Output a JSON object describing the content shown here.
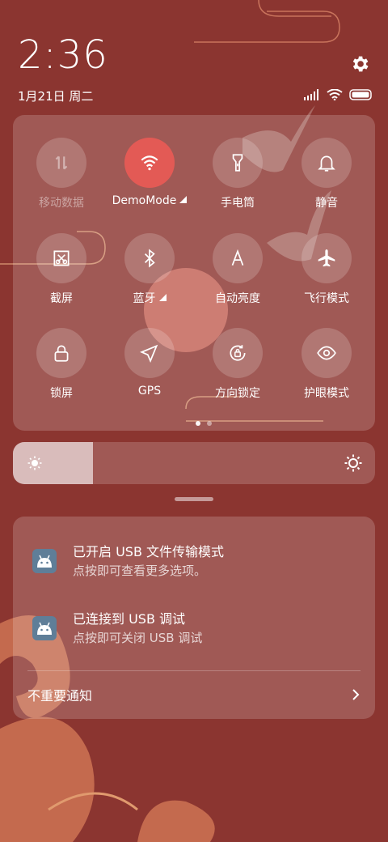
{
  "status": {
    "time": "2:36",
    "date": "1月21日 周二",
    "icons": [
      "signal-icon",
      "wifi-icon",
      "battery-icon"
    ]
  },
  "quick_settings": {
    "tiles": [
      {
        "label": "移动数据",
        "icon": "mobile-data-icon",
        "active": false,
        "disabled": true
      },
      {
        "label": "DemoMode",
        "icon": "wifi-icon",
        "active": true,
        "expand": true
      },
      {
        "label": "手电筒",
        "icon": "flashlight-icon",
        "active": false
      },
      {
        "label": "静音",
        "icon": "bell-icon",
        "active": false
      },
      {
        "label": "截屏",
        "icon": "screenshot-icon",
        "active": false
      },
      {
        "label": "蓝牙",
        "icon": "bluetooth-icon",
        "active": false,
        "expand": true
      },
      {
        "label": "自动亮度",
        "icon": "auto-brightness-icon",
        "active": false
      },
      {
        "label": "飞行模式",
        "icon": "airplane-icon",
        "active": false
      },
      {
        "label": "锁屏",
        "icon": "lock-icon",
        "active": false
      },
      {
        "label": "GPS",
        "icon": "gps-icon",
        "active": false
      },
      {
        "label": "方向锁定",
        "icon": "rotation-lock-icon",
        "active": false
      },
      {
        "label": "护眼模式",
        "icon": "eye-icon",
        "active": false
      }
    ],
    "page": 1,
    "page_count": 2
  },
  "brightness": {
    "level": 0.22
  },
  "notifications": [
    {
      "title": "已开启 USB 文件传输模式",
      "text": "点按即可查看更多选项。",
      "icon": "android-icon"
    },
    {
      "title": "已连接到 USB 调试",
      "text": "点按即可关闭 USB 调试",
      "icon": "android-icon"
    }
  ],
  "unimportant_label": "不重要通知",
  "colors": {
    "background": "#8b3530",
    "active_tile": "#e35a55",
    "app_icon": "#5f7e98"
  }
}
